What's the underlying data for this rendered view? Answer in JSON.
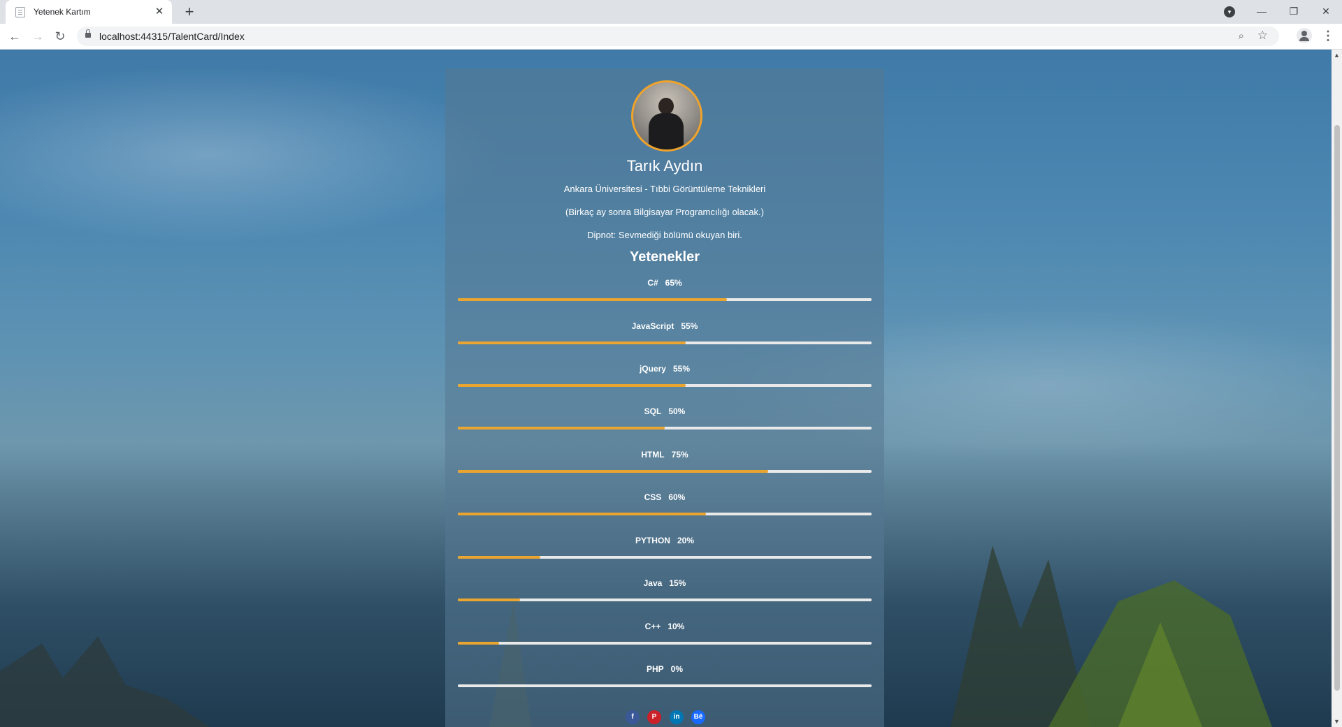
{
  "browser": {
    "tab_title": "Yetenek Kartım",
    "url": "localhost:44315/TalentCard/Index"
  },
  "profile": {
    "name": "Tarık Aydın",
    "line1": "Ankara Üniversitesi - Tıbbi Görüntüleme Teknikleri",
    "line2": "(Birkaç ay sonra Bilgisayar Programcılığı olacak.)",
    "line3": "Dipnot: Sevmediği bölümü okuyan biri."
  },
  "skills_title": "Yetenekler",
  "skills": [
    {
      "name": "C#",
      "percent_label": "65%",
      "value": 65
    },
    {
      "name": "JavaScript",
      "percent_label": "55%",
      "value": 55
    },
    {
      "name": "jQuery",
      "percent_label": "55%",
      "value": 55
    },
    {
      "name": "SQL",
      "percent_label": "50%",
      "value": 50
    },
    {
      "name": "HTML",
      "percent_label": "75%",
      "value": 75
    },
    {
      "name": "CSS",
      "percent_label": "60%",
      "value": 60
    },
    {
      "name": "PYTHON",
      "percent_label": "20%",
      "value": 20
    },
    {
      "name": "Java",
      "percent_label": "15%",
      "value": 15
    },
    {
      "name": "C++",
      "percent_label": "10%",
      "value": 10
    },
    {
      "name": "PHP",
      "percent_label": "0%",
      "value": 0
    }
  ],
  "socials": [
    {
      "icon": "facebook-icon",
      "glyph": "f",
      "color": "#3b5998"
    },
    {
      "icon": "pinterest-icon",
      "glyph": "P",
      "color": "#cb2027"
    },
    {
      "icon": "linkedin-icon",
      "glyph": "in",
      "color": "#0077b5"
    },
    {
      "icon": "behance-icon",
      "glyph": "Bē",
      "color": "#1769ff"
    }
  ],
  "colors": {
    "accent": "#e9a52f",
    "track": "#e9e9e9"
  }
}
